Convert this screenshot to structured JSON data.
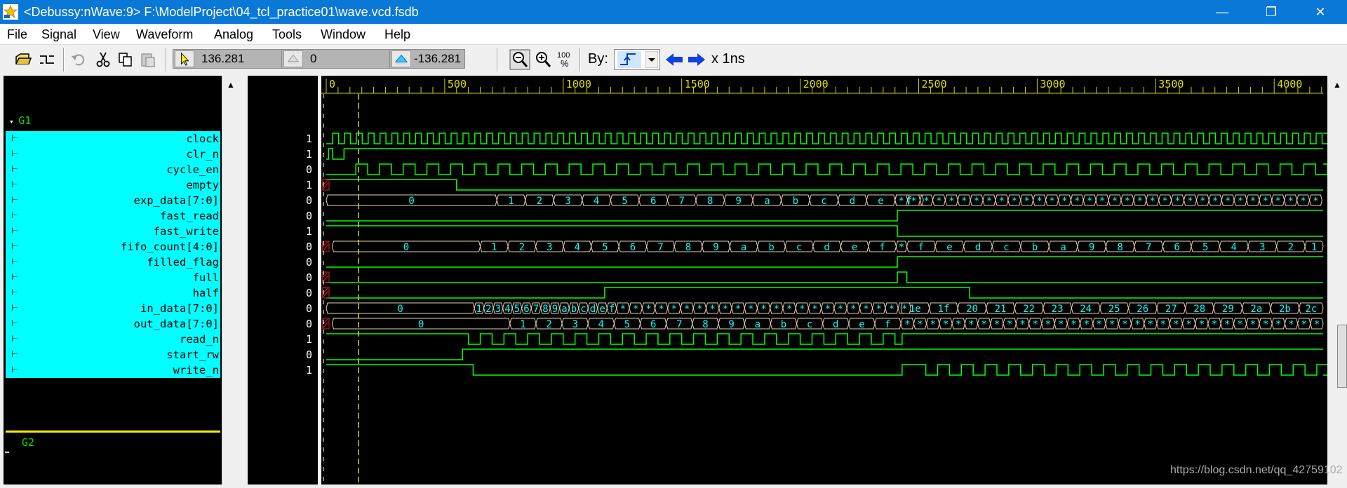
{
  "window": {
    "title": "<Debussy:nWave:9> F:\\ModelProject\\04_tcl_practice01\\wave.vcd.fsdb",
    "minimize": "—",
    "restore": "❐",
    "close": "✕"
  },
  "menu": [
    "File",
    "Signal",
    "View",
    "Waveform",
    "Analog",
    "Tools",
    "Window",
    "Help"
  ],
  "toolbar": {
    "cursor_time": "136.281",
    "marker_time": "0",
    "delta_time": "-136.281",
    "zoom_fit_label": "100\n%",
    "by_label": "By:",
    "unit_label": "x 1ns"
  },
  "groups": {
    "g1": "G1",
    "g2": "G2"
  },
  "ruler": {
    "labels": [
      "0",
      "500",
      "1000",
      "1500",
      "2000",
      "2500",
      "3000",
      "3500",
      "4000"
    ],
    "max_ns": 4000
  },
  "signals": [
    {
      "name": "clock",
      "value": "1"
    },
    {
      "name": "clr_n",
      "value": "1"
    },
    {
      "name": "cycle_en",
      "value": "0"
    },
    {
      "name": "empty",
      "value": "1"
    },
    {
      "name": "exp_data[7:0]",
      "value": "0"
    },
    {
      "name": "fast_read",
      "value": "0"
    },
    {
      "name": "fast_write",
      "value": "1"
    },
    {
      "name": "fifo_count[4:0]",
      "value": "0"
    },
    {
      "name": "filled_flag",
      "value": "0"
    },
    {
      "name": "full",
      "value": "0"
    },
    {
      "name": "half",
      "value": "0"
    },
    {
      "name": "in_data[7:0]",
      "value": "0"
    },
    {
      "name": "out_data[7:0]",
      "value": "0"
    },
    {
      "name": "read_n",
      "value": "1"
    },
    {
      "name": "start_rw",
      "value": "0"
    },
    {
      "name": "write_n",
      "value": "1"
    }
  ],
  "bus_values": {
    "exp_data": [
      "0",
      "1",
      "2",
      "3",
      "4",
      "5",
      "6",
      "7",
      "8",
      "9",
      "a",
      "b",
      "c",
      "d",
      "e",
      "f"
    ],
    "fifo_count_up": [
      "0",
      "1",
      "2",
      "3",
      "4",
      "5",
      "6",
      "7",
      "8",
      "9",
      "a",
      "b",
      "c",
      "d",
      "e",
      "f"
    ],
    "fifo_count_down": [
      "f",
      "e",
      "d",
      "c",
      "b",
      "a",
      "9",
      "8",
      "7",
      "6",
      "5",
      "4",
      "3",
      "2",
      "1"
    ],
    "in_data_a": [
      "0",
      "1",
      "2",
      "3",
      "4",
      "5",
      "6",
      "7",
      "8",
      "9",
      "a",
      "b",
      "c",
      "d",
      "e",
      "f"
    ],
    "in_data_b": [
      "1e",
      "1f",
      "20",
      "21",
      "22",
      "23",
      "24",
      "25",
      "26",
      "27",
      "28",
      "29",
      "2a",
      "2b",
      "2c"
    ],
    "out_data": [
      "0",
      "1",
      "2",
      "3",
      "4",
      "5",
      "6",
      "7",
      "8",
      "9",
      "a",
      "b",
      "c",
      "d",
      "e",
      "f"
    ],
    "collapsed_mark": "*"
  },
  "colors": {
    "clock_wave": "#00ff00",
    "low_wave": "#00c8d8",
    "bus_outline": "#e8d0b0",
    "bus_text": "#00ffff",
    "cursor": "#d8d800",
    "ruler_text": "#e0e000",
    "signal_bg": "#00ffff"
  },
  "watermark": "https://blog.csdn.net/qq_42759102"
}
